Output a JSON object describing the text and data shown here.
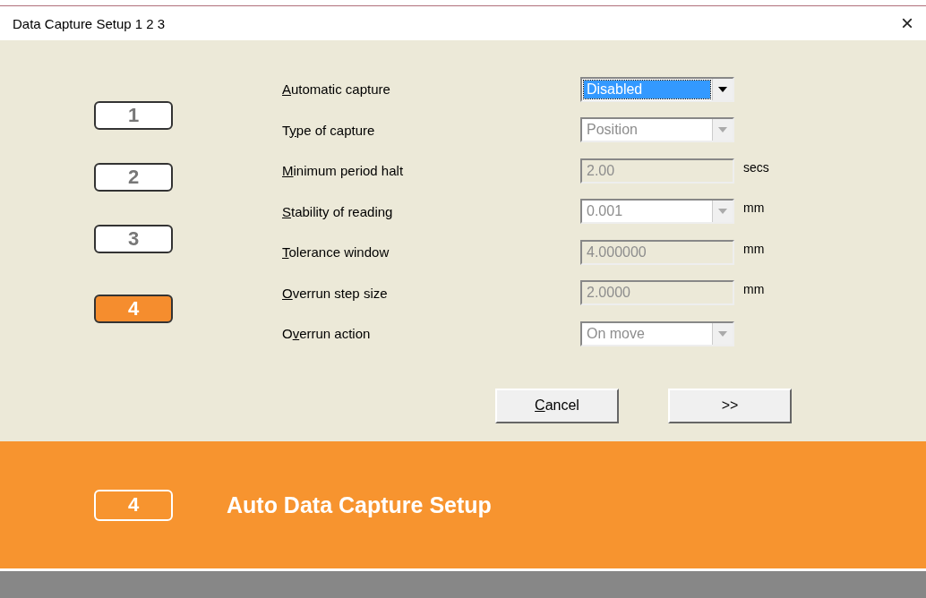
{
  "window": {
    "title": "Data Capture Setup 1 2 3",
    "close": "×"
  },
  "steps": [
    {
      "label": "1",
      "selected": false
    },
    {
      "label": "2",
      "selected": false
    },
    {
      "label": "3",
      "selected": false
    },
    {
      "label": "4",
      "selected": true
    }
  ],
  "fields": [
    {
      "access_key": "A",
      "label_rest": "utomatic capture",
      "kind": "dropdown",
      "value": "Disabled",
      "disabled": false,
      "focused": true
    },
    {
      "label_start": "T",
      "access_key": "y",
      "label_rest": "pe of capture",
      "kind": "dropdown",
      "value": "Position",
      "disabled": true,
      "focused": false
    },
    {
      "access_key": "M",
      "label_rest": "inimum period halt",
      "kind": "textbox",
      "value": "2.00",
      "unit": "secs",
      "disabled": true,
      "focused": false
    },
    {
      "access_key": "S",
      "label_rest": "tability of reading",
      "kind": "dropdown",
      "value": "0.001",
      "unit": "mm",
      "disabled": true,
      "focused": false
    },
    {
      "access_key": "T",
      "label_rest": "olerance window",
      "kind": "textbox",
      "value": "4.000000",
      "unit": "mm",
      "disabled": true,
      "focused": false
    },
    {
      "access_key": "O",
      "label_rest": "verrun step size",
      "kind": "textbox",
      "value": "2.0000",
      "unit": "mm",
      "disabled": true,
      "focused": false
    },
    {
      "label_start": "O",
      "access_key": "v",
      "label_rest": "errun action",
      "kind": "dropdown",
      "value": "On move",
      "disabled": true,
      "focused": false
    }
  ],
  "buttons": [
    {
      "access_key": "C",
      "label_rest": "ancel"
    },
    {
      "label_rest": ">>"
    }
  ],
  "banner": {
    "step": "4",
    "title": "Auto Data Capture Setup"
  }
}
